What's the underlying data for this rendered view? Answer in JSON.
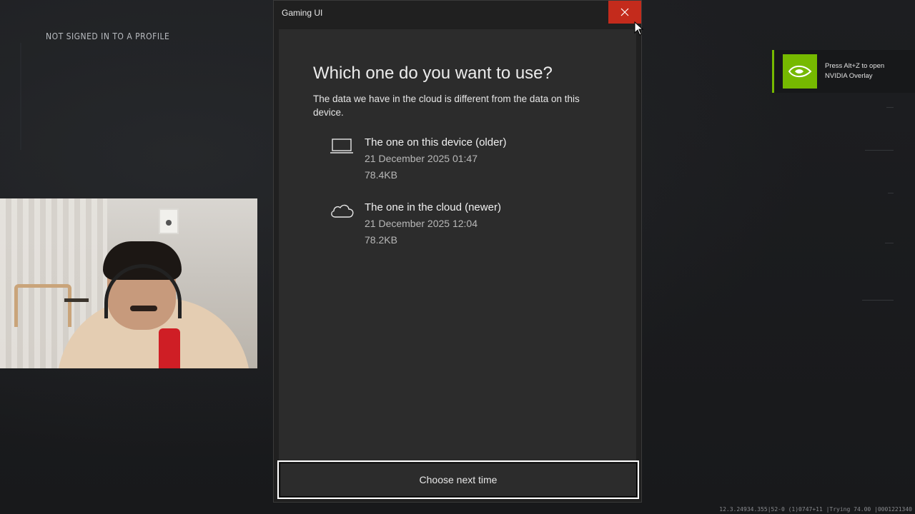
{
  "background": {
    "profile_status": "NOT SIGNED IN TO A PROFILE",
    "status_readout": "12.3.24934.355|52-0 (1)0747+11 |Trying 74.00 |0001221340"
  },
  "window": {
    "title": "Gaming UI",
    "close_icon": "close-icon"
  },
  "dialog": {
    "heading": "Which one do you want to use?",
    "description": "The data we have in the cloud is different from the data on this device.",
    "options": [
      {
        "icon": "laptop-icon",
        "name": "The one on this device (older)",
        "date": "21 December 2025 01:47",
        "size": "78.4KB"
      },
      {
        "icon": "cloud-icon",
        "name": "The one in the cloud (newer)",
        "date": "21 December 2025 12:04",
        "size": "78.2KB"
      }
    ],
    "choose_next_time_label": "Choose next time"
  },
  "nvidia_toast": {
    "line1": "Press Alt+Z to open",
    "line2": "NVIDIA Overlay",
    "accent": "#76b900"
  },
  "colors": {
    "close_button": "#c42b1c",
    "dialog_bg": "#2c2c2c"
  }
}
